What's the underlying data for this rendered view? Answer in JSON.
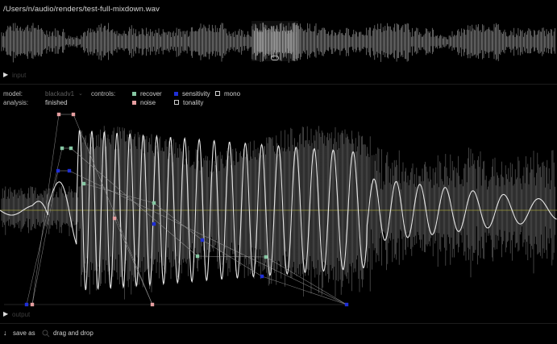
{
  "header": {
    "file_path": "/Users/n/audio/renders/test-full-mixdown.wav"
  },
  "input_row": {
    "play_icon": "play-icon",
    "label": "input"
  },
  "settings": {
    "model_label": "model:",
    "model_value": "blackadv1",
    "analysis_label": "analysis:",
    "analysis_value": "finished",
    "controls_label": "controls:"
  },
  "legend": [
    {
      "key": "recover",
      "label": "recover",
      "color": "#86c7a3",
      "filled": true
    },
    {
      "key": "sensitivity",
      "label": "sensitivity",
      "color": "#1f2fd6",
      "filled": true
    },
    {
      "key": "mono",
      "label": "mono",
      "color": "#cfcfcf",
      "filled": false
    },
    {
      "key": "noise",
      "label": "noise",
      "color": "#e69ea0",
      "filled": true
    },
    {
      "key": "tonality",
      "label": "tonality",
      "color": "#cfcfcf",
      "filled": false
    }
  ],
  "output_row": {
    "play_icon": "play-icon",
    "label": "output"
  },
  "bottom_bar": {
    "save_icon": "arrow-down-icon",
    "save_label": "save as",
    "drag_icon": "search-icon",
    "drag_label": "drag and drop"
  },
  "colors": {
    "background": "#000000",
    "waveform": "#7a7a7a",
    "sine": "#e6e6e6",
    "baseline": "#9d9a3a",
    "recover": "#86c7a3",
    "sensitivity": "#1f2fd6",
    "noise": "#e69ea0",
    "connector": "#9a9a9a"
  }
}
